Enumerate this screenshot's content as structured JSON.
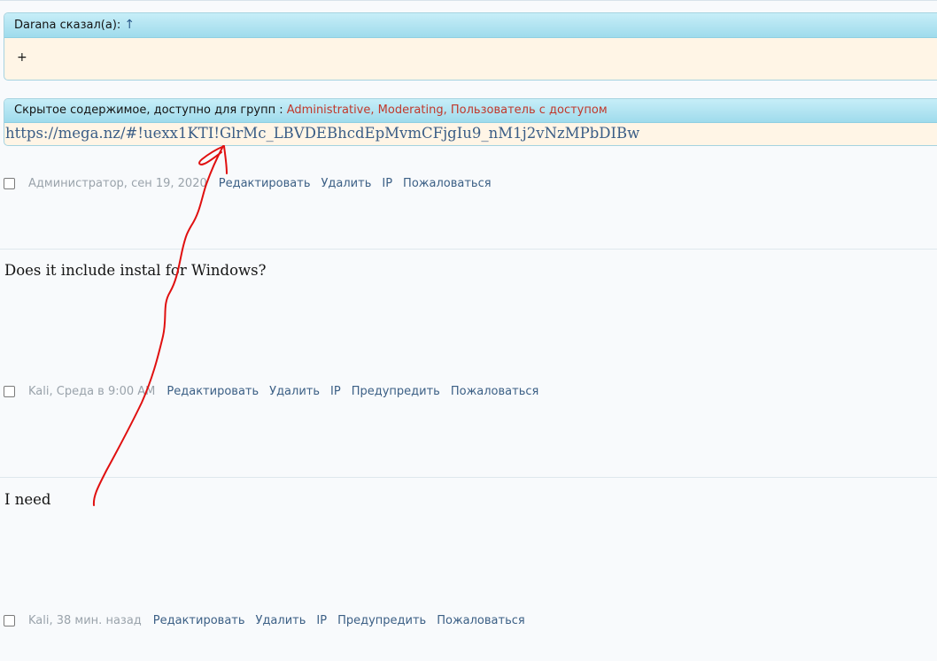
{
  "quote": {
    "author_line": "Darana сказал(а):",
    "arrow": "↑",
    "body": "+"
  },
  "hidden": {
    "prefix": "Скрытое содержимое, доступно для групп :",
    "groups": [
      "Administrative,",
      "Moderating,",
      "Пользователь с доступом"
    ],
    "link": "https://mega.nz/#!uexx1KTI!GlrMc_LBVDEBhcdEpMvmCFjgIu9_nM1j2vNzMPbDIBw"
  },
  "posts": [
    {
      "meta": "Администратор, сен 19, 2020",
      "actions": [
        "Редактировать",
        "Удалить",
        "IP",
        "Пожаловаться"
      ]
    },
    {
      "text": "Does it include instal for Windows?",
      "meta": "Kali, Среда в 9:00 AM",
      "actions": [
        "Редактировать",
        "Удалить",
        "IP",
        "Предупредить",
        "Пожаловаться"
      ]
    },
    {
      "text": "I need",
      "meta": "Kali, 38 мин. назад",
      "actions": [
        "Редактировать",
        "Удалить",
        "IP",
        "Предупредить",
        "Пожаловаться"
      ]
    }
  ],
  "colors": {
    "quote_header": "#a8e0ef",
    "quote_body": "#fff5e6",
    "group_text": "#c0382b",
    "link_text": "#3a5d86",
    "annotation_stroke": "#e01010"
  }
}
